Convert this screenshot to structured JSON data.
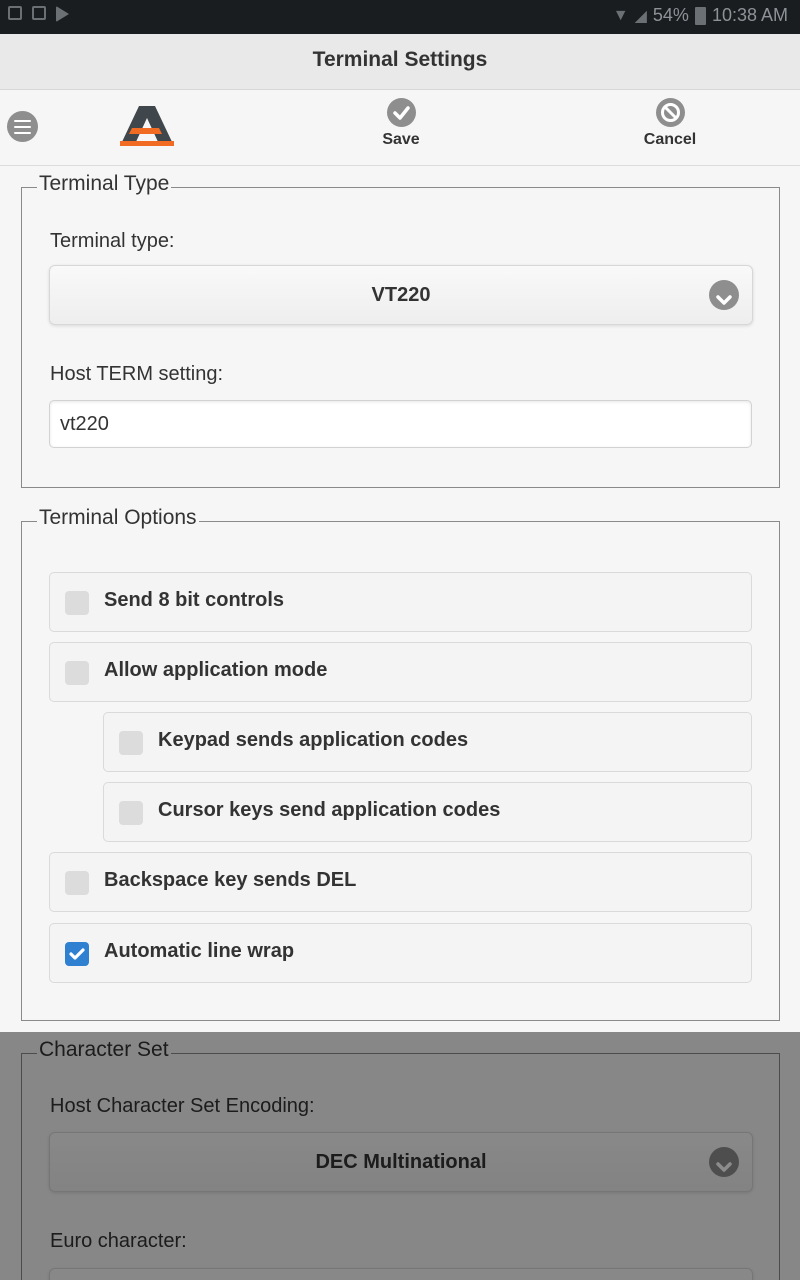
{
  "status_bar": {
    "battery": "54%",
    "time": "10:38 AM"
  },
  "header": {
    "title": "Terminal Settings"
  },
  "toolbar": {
    "save_label": "Save",
    "cancel_label": "Cancel"
  },
  "terminal_type": {
    "legend": "Terminal Type",
    "type_label": "Terminal type:",
    "type_value": "VT220",
    "host_term_label": "Host TERM setting:",
    "host_term_value": "vt220"
  },
  "terminal_options": {
    "legend": "Terminal Options",
    "items": [
      {
        "label": "Send 8 bit controls",
        "checked": false
      },
      {
        "label": "Allow application mode",
        "checked": false
      },
      {
        "label": "Keypad sends application codes",
        "checked": false
      },
      {
        "label": "Cursor keys send application codes",
        "checked": false
      },
      {
        "label": "Backspace key sends DEL",
        "checked": false
      },
      {
        "label": "Automatic line wrap",
        "checked": true
      }
    ]
  },
  "character_set": {
    "legend": "Character Set",
    "encoding_label": "Host Character Set Encoding:",
    "encoding_value": "DEC Multinational",
    "euro_label": "Euro character:"
  },
  "colors": {
    "accent": "#2f80d1",
    "logo_orange": "#f26b22",
    "logo_dark": "#3f464c"
  }
}
